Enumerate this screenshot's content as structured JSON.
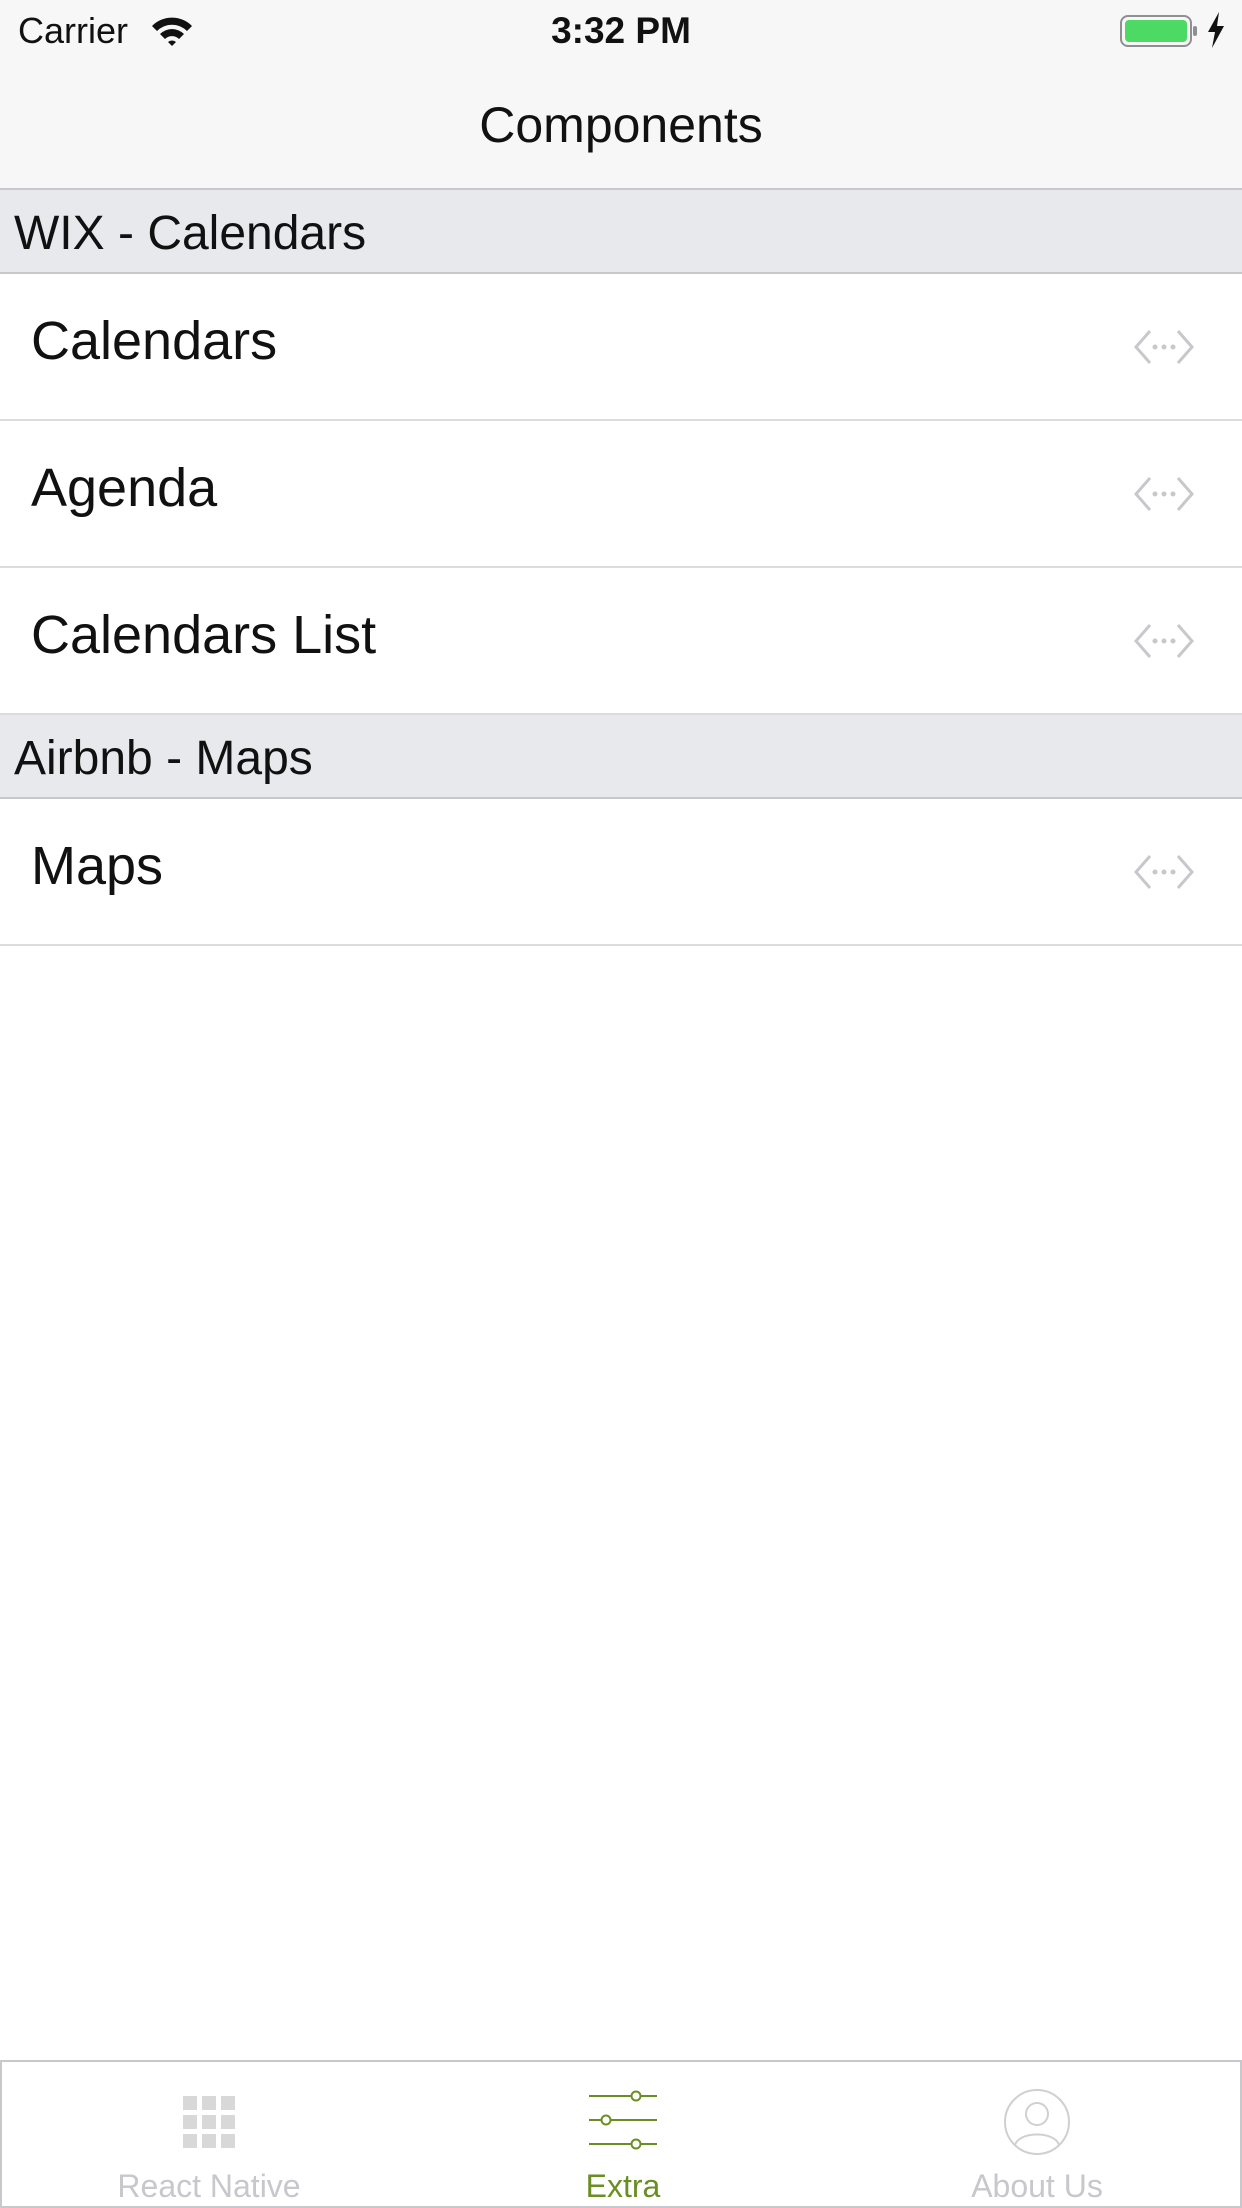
{
  "status_bar": {
    "carrier": "Carrier",
    "time": "3:32 PM"
  },
  "nav": {
    "title": "Components"
  },
  "sections": [
    {
      "header": "WIX - Calendars",
      "items": [
        {
          "label": "Calendars",
          "icon": "code-icon"
        },
        {
          "label": "Agenda",
          "icon": "code-icon"
        },
        {
          "label": "Calendars List",
          "icon": "code-icon"
        }
      ]
    },
    {
      "header": "Airbnb - Maps",
      "items": [
        {
          "label": "Maps",
          "icon": "code-icon"
        }
      ]
    }
  ],
  "tab_bar": {
    "tabs": [
      {
        "label": "React Native",
        "icon": "grid-icon",
        "selected": false
      },
      {
        "label": "Extra",
        "icon": "sliders-icon",
        "selected": true
      },
      {
        "label": "About Us",
        "icon": "user-icon",
        "selected": false
      }
    ]
  },
  "colors": {
    "accent": "#6b8e23",
    "inactive": "#c7c7cc",
    "section_bg": "#e8e9ec",
    "battery": "#4cd964"
  }
}
